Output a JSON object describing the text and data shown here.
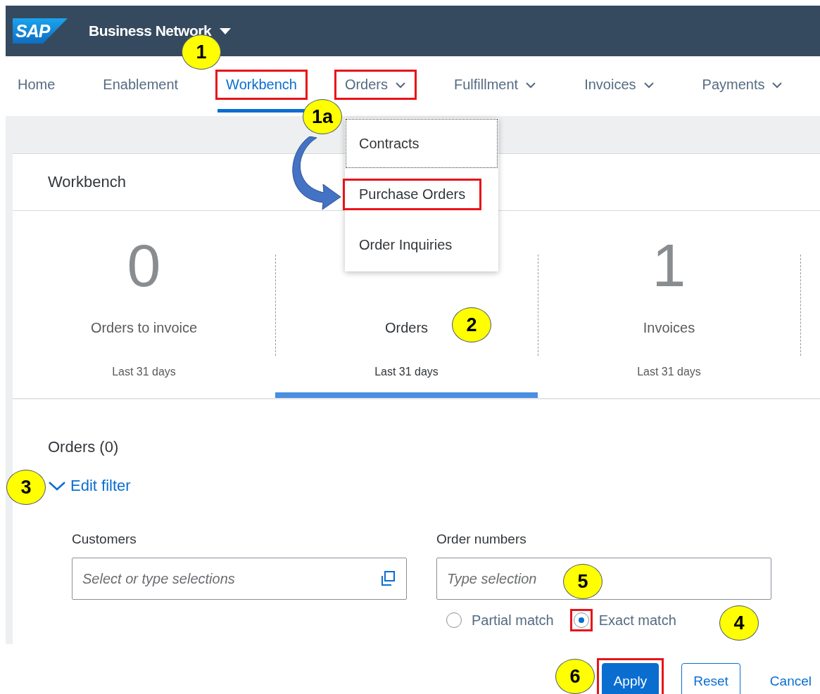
{
  "header": {
    "logo": "SAP",
    "product": "Business Network"
  },
  "nav": [
    {
      "label": "Home",
      "selected": false,
      "dropdown": false,
      "highlighted": false
    },
    {
      "label": "Enablement",
      "selected": false,
      "dropdown": false,
      "highlighted": false
    },
    {
      "label": "Workbench",
      "selected": true,
      "dropdown": false,
      "highlighted": true
    },
    {
      "label": "Orders",
      "selected": false,
      "dropdown": true,
      "highlighted": true
    },
    {
      "label": "Fulfillment",
      "selected": false,
      "dropdown": true,
      "highlighted": false
    },
    {
      "label": "Invoices",
      "selected": false,
      "dropdown": true,
      "highlighted": false
    },
    {
      "label": "Payments",
      "selected": false,
      "dropdown": true,
      "highlighted": false
    }
  ],
  "orders_menu": [
    {
      "label": "Contracts",
      "focused": true,
      "highlighted": false
    },
    {
      "label": "Purchase Orders",
      "focused": false,
      "highlighted": true
    },
    {
      "label": "Order Inquiries",
      "focused": false,
      "highlighted": false
    }
  ],
  "card": {
    "title": "Workbench",
    "tiles": [
      {
        "count": "0",
        "label": "Orders to invoice",
        "period": "Last 31 days",
        "selected": false
      },
      {
        "label": "Orders",
        "period": "Last 31 days",
        "selected": true
      },
      {
        "count": "1",
        "label": "Invoices",
        "period": "Last 31 days",
        "selected": false
      }
    ]
  },
  "results_title": "Orders (0)",
  "filter": {
    "toggle": "Edit filter",
    "customers": {
      "label": "Customers",
      "placeholder": "Select or type selections"
    },
    "order_numbers": {
      "label": "Order numbers",
      "placeholder": "Type selection"
    },
    "match": [
      {
        "label": "Partial match",
        "selected": false,
        "highlighted": false
      },
      {
        "label": "Exact match",
        "selected": true,
        "highlighted": true
      }
    ]
  },
  "buttons": [
    {
      "label": "Apply",
      "kind": "primary",
      "highlighted": true
    },
    {
      "label": "Reset",
      "kind": "secondary",
      "highlighted": false
    },
    {
      "label": "Cancel",
      "kind": "link",
      "highlighted": false
    }
  ],
  "callouts": [
    {
      "label": "1"
    },
    {
      "label": "1a"
    },
    {
      "label": "2"
    },
    {
      "label": "3"
    },
    {
      "label": "4"
    },
    {
      "label": "5"
    },
    {
      "label": "6"
    }
  ]
}
